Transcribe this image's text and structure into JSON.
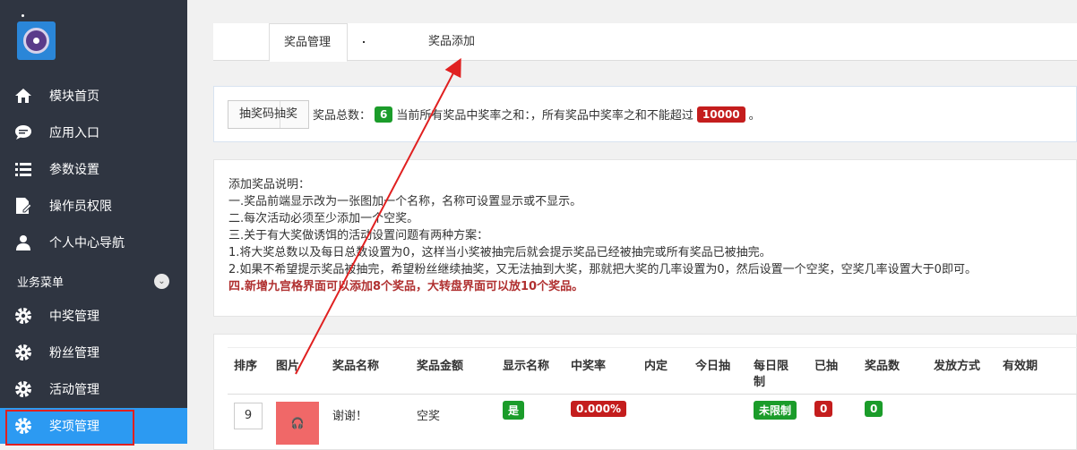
{
  "sidebar": {
    "items": [
      {
        "label": "模块首页",
        "icon": "home-icon"
      },
      {
        "label": "应用入口",
        "icon": "chat-icon"
      },
      {
        "label": "参数设置",
        "icon": "list-icon"
      },
      {
        "label": "操作员权限",
        "icon": "edit-icon"
      },
      {
        "label": "个人中心导航",
        "icon": "user-icon"
      }
    ],
    "section_label": "业务菜单",
    "section_items": [
      {
        "label": "中奖管理",
        "icon": "gear-icon"
      },
      {
        "label": "粉丝管理",
        "icon": "gear-icon"
      },
      {
        "label": "活动管理",
        "icon": "gear-icon"
      },
      {
        "label": "奖项管理",
        "icon": "gear-icon"
      }
    ]
  },
  "tabs": {
    "tab1": "奖品管理",
    "tab2": "奖品添加"
  },
  "summary": {
    "draw_button": "抽奖码抽奖",
    "total_label": "奖品总数：",
    "total_value": "6",
    "rate_text": "当前所有奖品中奖率之和：，所有奖品中奖率之和不能超过",
    "rate_max": "10000",
    "end": "。"
  },
  "notes": {
    "title": "添加奖品说明：",
    "l1": "一.奖品前端显示改为一张图加一个名称，名称可设置显示或不显示。",
    "l2": "二.每次活动必须至少添加一个空奖。",
    "l3": "三.关于有大奖做诱饵的活动设置问题有两种方案：",
    "l4": "1.将大奖总数以及每日总数设置为0，这样当小奖被抽完后就会提示奖品已经被抽完或所有奖品已被抽完。",
    "l5": "2.如果不希望提示奖品被抽完，希望粉丝继续抽奖，又无法抽到大奖，那就把大奖的几率设置为0，然后设置一个空奖，空奖几率设置大于0即可。",
    "l6": "四.新增九宫格界面可以添加8个奖品，大转盘界面可以放10个奖品。"
  },
  "table": {
    "headers": [
      "排序",
      "图片",
      "奖品名称",
      "奖品金额",
      "显示名称",
      "中奖率",
      "内定",
      "今日抽",
      "每日限",
      "制",
      "已抽",
      "奖品数",
      "发放方式",
      "有效期"
    ],
    "row": {
      "sort": "9",
      "name": "谢谢！",
      "amount": "空奖",
      "show_name": "是",
      "rate": "0.000%",
      "daily_limit": "未限制",
      "drawn": "0",
      "count": "0"
    }
  },
  "colors": {
    "sidebar_bg": "#2f3541",
    "active": "#2c9af2",
    "green": "#1b9c2a",
    "red": "#c41d1d"
  }
}
